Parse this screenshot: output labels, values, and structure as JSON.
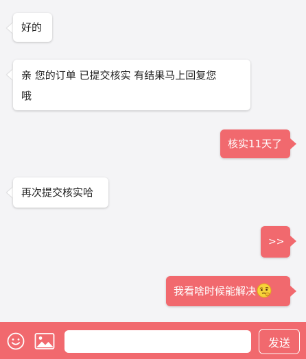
{
  "colors": {
    "accent": "#f1696e",
    "background": "#f4f4f6",
    "incoming_bubble": "#ffffff"
  },
  "messages": [
    {
      "direction": "incoming",
      "lines": [
        "好的"
      ]
    },
    {
      "direction": "incoming",
      "lines": [
        "亲 您的订单 已提交核实 有结果马上回复您",
        "哦"
      ]
    },
    {
      "direction": "outgoing",
      "lines": [
        "核实11天了"
      ]
    },
    {
      "direction": "incoming",
      "lines": [
        "再次提交核实哈"
      ]
    },
    {
      "direction": "outgoing",
      "lines": [
        ">>"
      ]
    },
    {
      "direction": "outgoing",
      "lines": [
        "我看啥时候能解决"
      ],
      "emoji": "thinking-face-icon"
    }
  ],
  "input_bar": {
    "emoji_icon": "smiley-icon",
    "image_icon": "image-icon",
    "input_value": "",
    "send_label": "发送"
  }
}
